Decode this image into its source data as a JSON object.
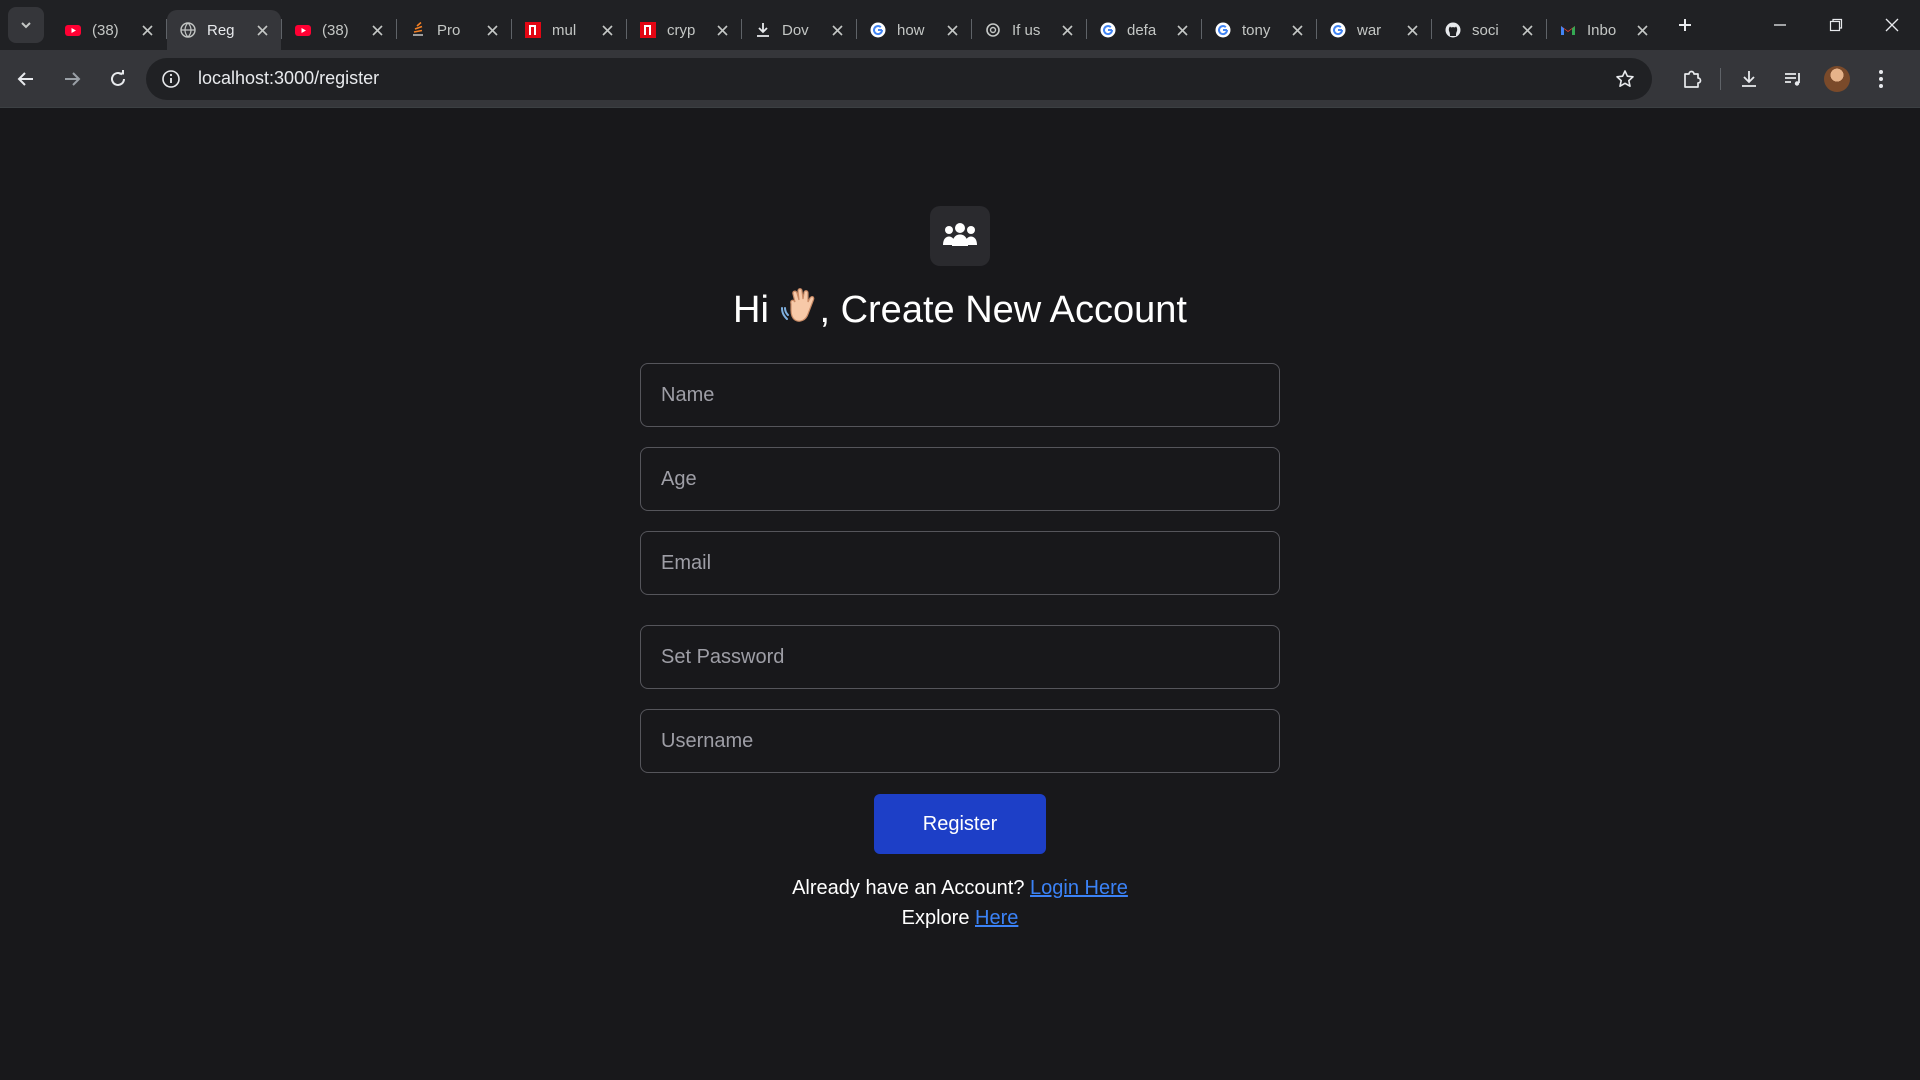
{
  "browser": {
    "tabs": [
      {
        "title": "(38)",
        "icon": "youtube-icon"
      },
      {
        "title": "Reg",
        "icon": "globe-icon",
        "active": true
      },
      {
        "title": "(38)",
        "icon": "youtube-icon"
      },
      {
        "title": "Pro",
        "icon": "stack-icon"
      },
      {
        "title": "mul",
        "icon": "n-logo-icon"
      },
      {
        "title": "cryp",
        "icon": "n-logo-icon"
      },
      {
        "title": "Dov",
        "icon": "download-icon"
      },
      {
        "title": "how",
        "icon": "google-icon"
      },
      {
        "title": "If us",
        "icon": "openai-icon"
      },
      {
        "title": "defa",
        "icon": "google-icon"
      },
      {
        "title": "tony",
        "icon": "google-icon"
      },
      {
        "title": "war",
        "icon": "google-icon"
      },
      {
        "title": "soci",
        "icon": "github-icon"
      },
      {
        "title": "Inbo",
        "icon": "gmail-icon"
      }
    ],
    "url": "localhost:3000/register"
  },
  "form": {
    "heading_pre": "Hi",
    "heading_post": ", Create New Account",
    "name_placeholder": "Name",
    "age_placeholder": "Age",
    "email_placeholder": "Email",
    "password_placeholder": "Set Password",
    "username_placeholder": "Username",
    "register_label": "Register",
    "login_prompt": "Already have an Account?",
    "login_link": "Login Here",
    "explore_prompt": "Explore",
    "explore_link": "Here"
  },
  "colors": {
    "page_bg": "#18181b",
    "button_bg": "#1d3fc7",
    "link": "#3b82f6"
  }
}
